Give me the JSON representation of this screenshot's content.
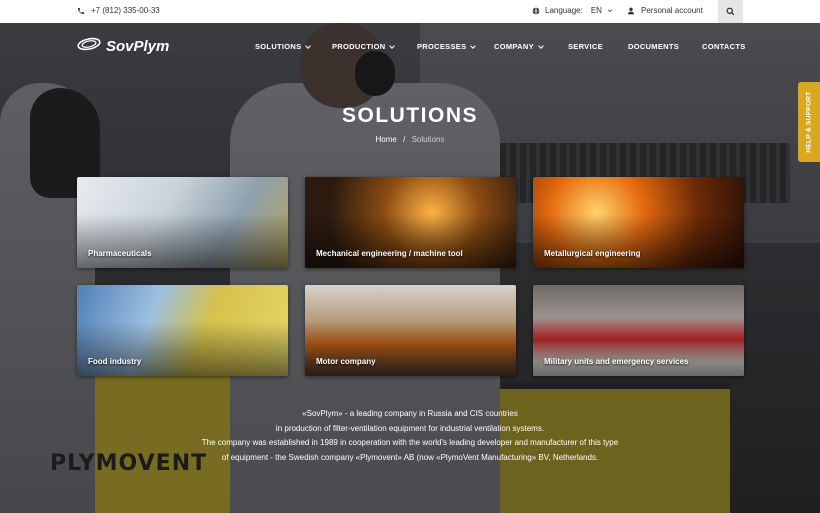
{
  "topbar": {
    "phone": "+7 (812) 335-00-33",
    "language_label": "Language:",
    "language_value": "EN",
    "account_label": "Personal account"
  },
  "logo": {
    "text": "SovPlym"
  },
  "nav": {
    "items": [
      {
        "label": "SOLUTIONS",
        "dropdown": true
      },
      {
        "label": "PRODUCTION",
        "dropdown": true
      },
      {
        "label": "PROCESSES",
        "dropdown": true
      },
      {
        "label": "COMPANY",
        "dropdown": true
      },
      {
        "label": "SERVICE",
        "dropdown": false
      },
      {
        "label": "DOCUMENTS",
        "dropdown": false
      },
      {
        "label": "CONTACTS",
        "dropdown": false
      }
    ]
  },
  "page": {
    "title": "SOLUTIONS",
    "breadcrumb": {
      "home": "Home",
      "separator": "/",
      "current": "Solutions"
    }
  },
  "cards": [
    {
      "label": "Pharmaceuticals"
    },
    {
      "label": "Mechanical engineering / machine tool"
    },
    {
      "label": "Metallurgical engineering"
    },
    {
      "label": "Food industry"
    },
    {
      "label": "Motor company"
    },
    {
      "label": "Military units and emergency services"
    }
  ],
  "about": {
    "line1": "«SovPlym» - a leading company in Russia and CIS countries",
    "line2": "in production of filter-ventilation equipment for industrial ventilation systems.",
    "line3": "The company was established in 1989 in cooperation with the world's leading developer and manufacturer of this type",
    "line4": "of equipment - the Swedish company «Plymovent» AB (now «PlymoVent Manufacturing» BV, Netherlands."
  },
  "background_brand": "PLYMOVENT",
  "help_tab": {
    "label": "HELP & SUPPORT"
  },
  "colors": {
    "accent": "#d9a820",
    "topbar_bg": "#ffffff",
    "text_light": "#ffffff"
  }
}
